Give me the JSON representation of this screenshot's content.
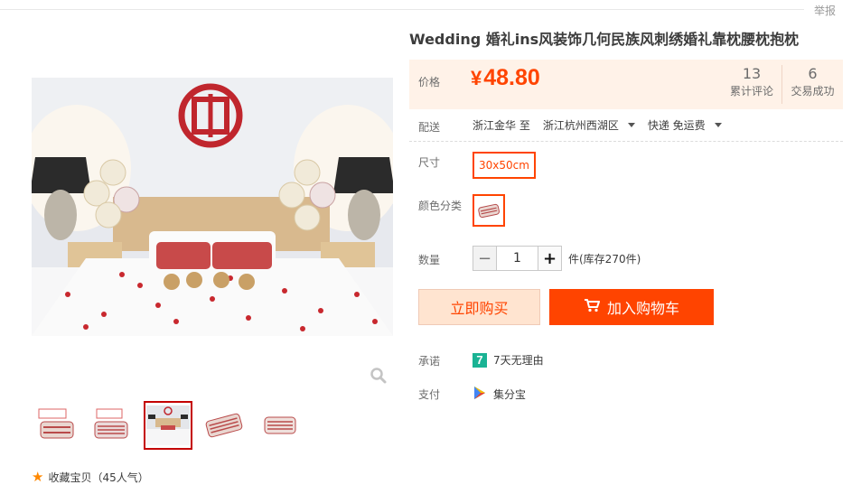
{
  "header": {
    "report_label": "举报"
  },
  "product": {
    "title": "Wedding 婚礼ins风装饰几何民族风刺绣婚礼靠枕腰枕抱枕",
    "price_label": "价格",
    "currency": "¥",
    "price": "48.80",
    "reviews_count": "13",
    "reviews_label": "累计评论",
    "sales_count": "6",
    "sales_label": "交易成功"
  },
  "shipping": {
    "label": "配送",
    "from": "浙江金华 至",
    "to": "浙江杭州西湖区",
    "method": "快递 免运费"
  },
  "size": {
    "label": "尺寸",
    "selected": "30x50cm"
  },
  "color": {
    "label": "颜色分类"
  },
  "quantity": {
    "label": "数量",
    "value": "1",
    "minus": "−",
    "plus": "+",
    "stock_text": "件(库存270件)"
  },
  "actions": {
    "buy_now": "立即购买",
    "add_to_cart": "加入购物车"
  },
  "promise": {
    "label": "承诺",
    "badge": "7",
    "text": "7天无理由"
  },
  "payment": {
    "label": "支付",
    "text": "集分宝"
  },
  "favorite": {
    "text": "收藏宝贝（45人气）"
  },
  "thumbnails": {
    "count": 5,
    "active_index": 2
  },
  "colors": {
    "accent": "#ff4400",
    "price_bg": "#fff2e8",
    "buy_now_bg": "#ffe4d0",
    "promise_badge": "#1ab394"
  }
}
